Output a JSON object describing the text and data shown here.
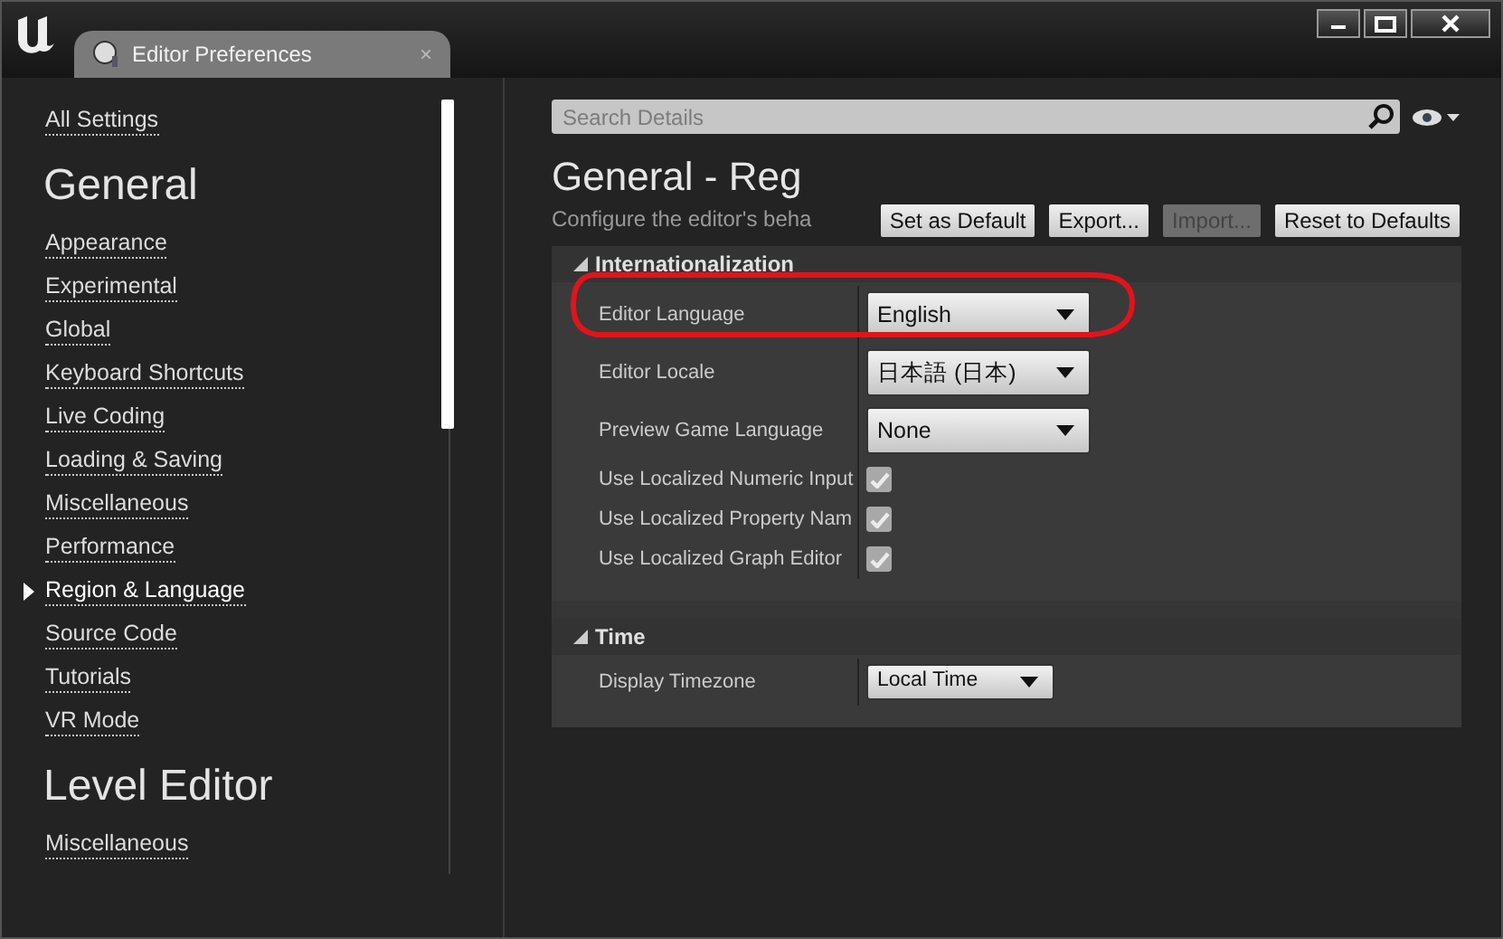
{
  "window": {
    "title": "Editor Preferences",
    "tab_close": "×"
  },
  "sidebar": {
    "top_link": "All Settings",
    "sections": [
      {
        "title": "General",
        "items": [
          {
            "label": "Appearance",
            "selected": false
          },
          {
            "label": "Experimental",
            "selected": false
          },
          {
            "label": "Global",
            "selected": false
          },
          {
            "label": "Keyboard Shortcuts",
            "selected": false
          },
          {
            "label": "Live Coding",
            "selected": false
          },
          {
            "label": "Loading & Saving",
            "selected": false
          },
          {
            "label": "Miscellaneous",
            "selected": false
          },
          {
            "label": "Performance",
            "selected": false
          },
          {
            "label": "Region & Language",
            "selected": true
          },
          {
            "label": "Source Code",
            "selected": false
          },
          {
            "label": "Tutorials",
            "selected": false
          },
          {
            "label": "VR Mode",
            "selected": false
          }
        ]
      },
      {
        "title": "Level Editor",
        "items": [
          {
            "label": "Miscellaneous",
            "selected": false
          }
        ]
      }
    ]
  },
  "search": {
    "placeholder": "Search Details"
  },
  "page": {
    "title": "General - Reg",
    "subtitle": "Configure the editor's beha"
  },
  "buttons": [
    {
      "label": "Set as Default",
      "disabled": false
    },
    {
      "label": "Export...",
      "disabled": false
    },
    {
      "label": "Import...",
      "disabled": true
    },
    {
      "label": "Reset to Defaults",
      "disabled": false
    }
  ],
  "categories": [
    {
      "title": "Internationalization",
      "expanded": true,
      "rows": [
        {
          "kind": "dropdown",
          "label": "Editor Language",
          "value": "English",
          "highlighted": true
        },
        {
          "kind": "dropdown",
          "label": "Editor Locale",
          "value": "日本語 (日本)",
          "highlighted": false
        },
        {
          "kind": "dropdown",
          "label": "Preview Game Language",
          "value": "None",
          "highlighted": false
        },
        {
          "kind": "checkbox",
          "label": "Use Localized Numeric Input",
          "checked": true
        },
        {
          "kind": "checkbox",
          "label": "Use Localized Property Nam",
          "checked": true
        },
        {
          "kind": "checkbox",
          "label": "Use Localized Graph Editor",
          "checked": true
        }
      ]
    },
    {
      "title": "Time",
      "expanded": true,
      "rows": [
        {
          "kind": "smalldropdown",
          "label": "Display Timezone",
          "value": "Local Time",
          "highlighted": false
        }
      ]
    }
  ]
}
